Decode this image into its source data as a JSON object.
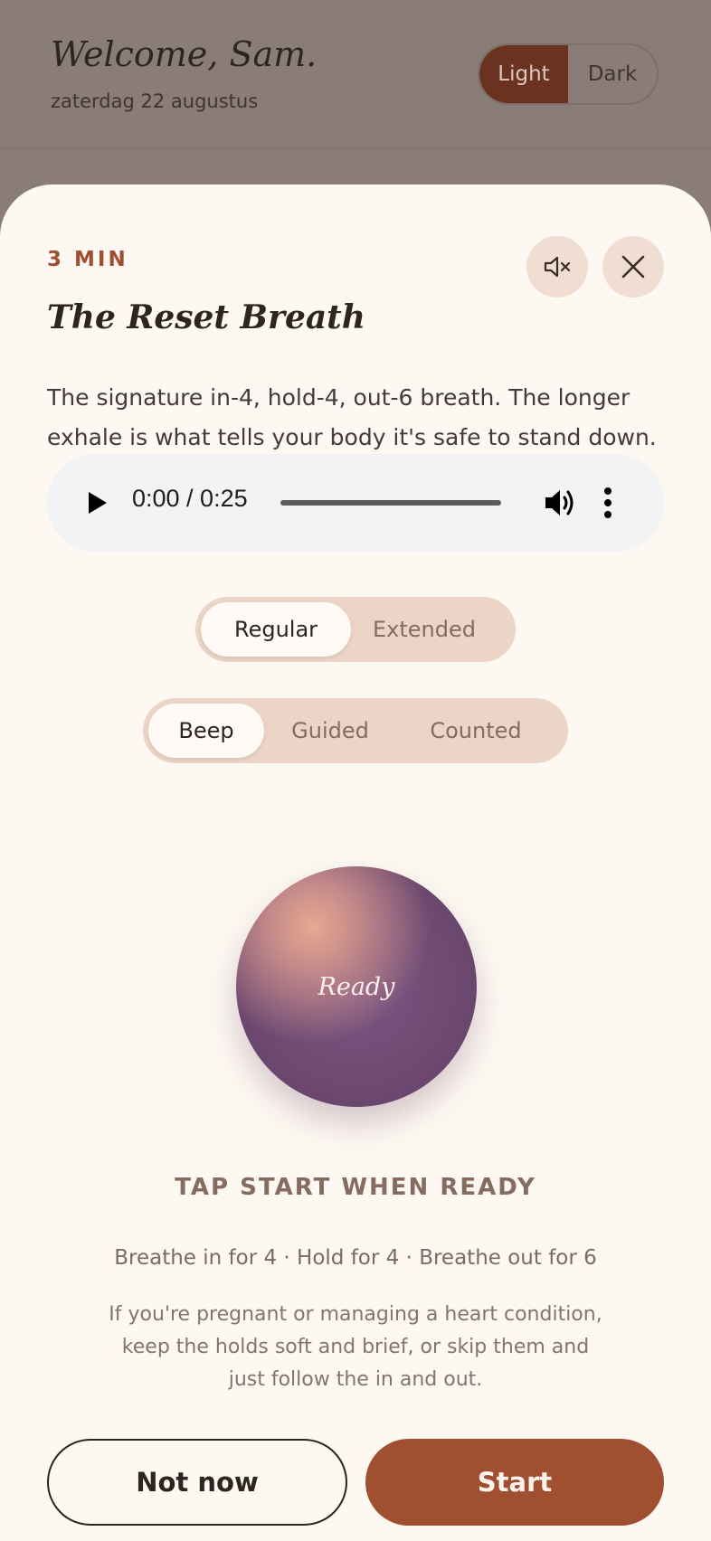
{
  "header": {
    "welcome": "Welcome, Sam.",
    "date": "zaterdag 22 augustus",
    "theme": {
      "options": [
        "Light",
        "Dark"
      ],
      "selected": "Light"
    }
  },
  "sheet": {
    "duration": "3 MIN",
    "title": "The Reset Breath",
    "description": "The signature in-4, hold-4, out-6 breath. The longer exhale is what tells your body it's safe to stand down.",
    "mute_icon": "speaker-muted-icon",
    "close_icon": "close-icon"
  },
  "audio": {
    "time": "0:00 / 0:25",
    "progress": 0
  },
  "length_toggle": {
    "options": [
      "Regular",
      "Extended"
    ],
    "selected": "Regular"
  },
  "sound_toggle": {
    "options": [
      "Beep",
      "Guided",
      "Counted"
    ],
    "selected": "Beep"
  },
  "orb": {
    "label": "Ready"
  },
  "prompt": "TAP START WHEN READY",
  "pattern": "Breathe in for 4 · Hold for 4 · Breathe out for 6",
  "note": "If you're pregnant or managing a heart condition, keep the holds soft and brief, or skip them and just follow the in and out.",
  "actions": {
    "secondary": "Not now",
    "primary": "Start"
  },
  "colors": {
    "accent": "#a14f31",
    "sheet_background": "#fdf8f2",
    "overlay": "#8a7d78",
    "segment_background": "#ecd5c6"
  }
}
